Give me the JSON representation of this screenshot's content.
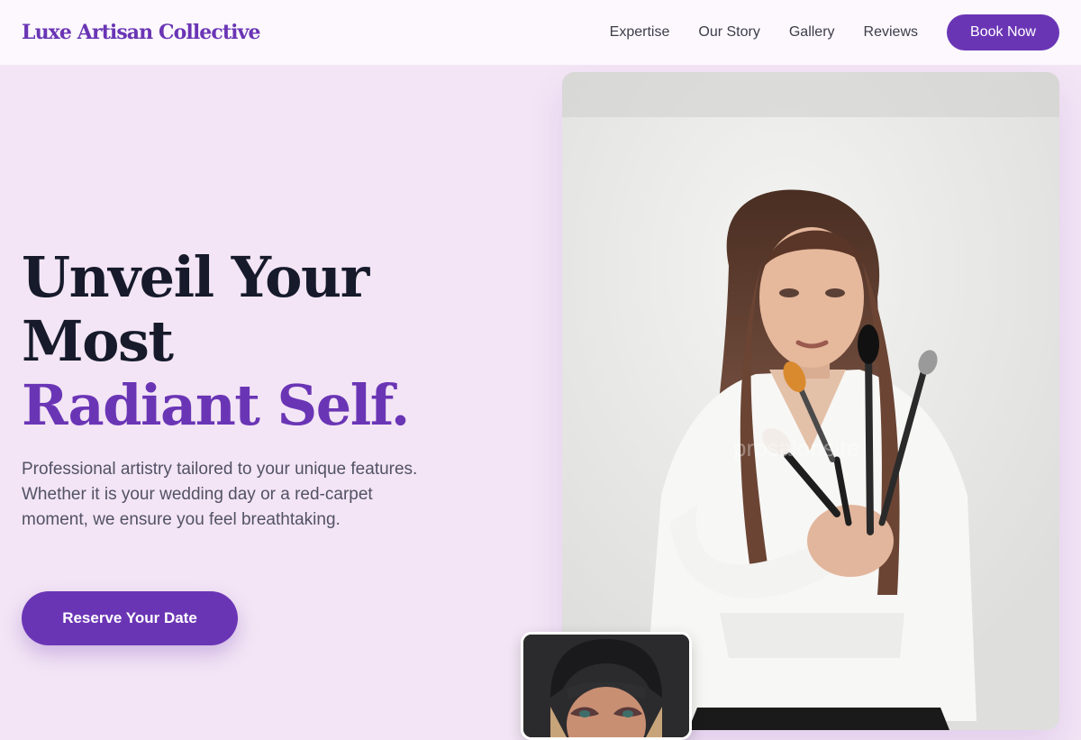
{
  "header": {
    "brand": "Luxe Artisan Collective",
    "nav": [
      {
        "label": "Expertise"
      },
      {
        "label": "Our Story"
      },
      {
        "label": "Gallery"
      },
      {
        "label": "Reviews"
      }
    ],
    "book_label": "Book Now"
  },
  "hero": {
    "headline_line1": "Unveil Your",
    "headline_line2": "Most",
    "headline_accent": "Radiant Self.",
    "subtitle": "Professional artistry tailored to your unique features. Whether it is your wedding day or a red-carpet moment, we ensure you feel breathtaking.",
    "cta_label": "Reserve Your Date",
    "image_watermark": "prosalonsite"
  },
  "colors": {
    "accent": "#6a35b5",
    "page_background": "#f3e5f5",
    "header_background": "#fcf8fd",
    "headline": "#161a2b"
  }
}
